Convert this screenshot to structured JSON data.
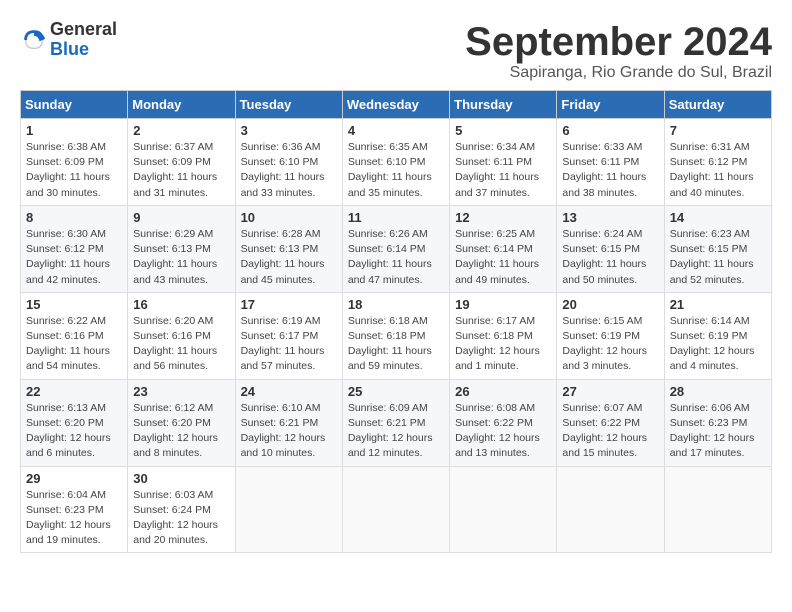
{
  "logo": {
    "general": "General",
    "blue": "Blue"
  },
  "title": "September 2024",
  "subtitle": "Sapiranga, Rio Grande do Sul, Brazil",
  "headers": [
    "Sunday",
    "Monday",
    "Tuesday",
    "Wednesday",
    "Thursday",
    "Friday",
    "Saturday"
  ],
  "weeks": [
    [
      {
        "day": "1",
        "sunrise": "Sunrise: 6:38 AM",
        "sunset": "Sunset: 6:09 PM",
        "daylight": "Daylight: 11 hours and 30 minutes."
      },
      {
        "day": "2",
        "sunrise": "Sunrise: 6:37 AM",
        "sunset": "Sunset: 6:09 PM",
        "daylight": "Daylight: 11 hours and 31 minutes."
      },
      {
        "day": "3",
        "sunrise": "Sunrise: 6:36 AM",
        "sunset": "Sunset: 6:10 PM",
        "daylight": "Daylight: 11 hours and 33 minutes."
      },
      {
        "day": "4",
        "sunrise": "Sunrise: 6:35 AM",
        "sunset": "Sunset: 6:10 PM",
        "daylight": "Daylight: 11 hours and 35 minutes."
      },
      {
        "day": "5",
        "sunrise": "Sunrise: 6:34 AM",
        "sunset": "Sunset: 6:11 PM",
        "daylight": "Daylight: 11 hours and 37 minutes."
      },
      {
        "day": "6",
        "sunrise": "Sunrise: 6:33 AM",
        "sunset": "Sunset: 6:11 PM",
        "daylight": "Daylight: 11 hours and 38 minutes."
      },
      {
        "day": "7",
        "sunrise": "Sunrise: 6:31 AM",
        "sunset": "Sunset: 6:12 PM",
        "daylight": "Daylight: 11 hours and 40 minutes."
      }
    ],
    [
      {
        "day": "8",
        "sunrise": "Sunrise: 6:30 AM",
        "sunset": "Sunset: 6:12 PM",
        "daylight": "Daylight: 11 hours and 42 minutes."
      },
      {
        "day": "9",
        "sunrise": "Sunrise: 6:29 AM",
        "sunset": "Sunset: 6:13 PM",
        "daylight": "Daylight: 11 hours and 43 minutes."
      },
      {
        "day": "10",
        "sunrise": "Sunrise: 6:28 AM",
        "sunset": "Sunset: 6:13 PM",
        "daylight": "Daylight: 11 hours and 45 minutes."
      },
      {
        "day": "11",
        "sunrise": "Sunrise: 6:26 AM",
        "sunset": "Sunset: 6:14 PM",
        "daylight": "Daylight: 11 hours and 47 minutes."
      },
      {
        "day": "12",
        "sunrise": "Sunrise: 6:25 AM",
        "sunset": "Sunset: 6:14 PM",
        "daylight": "Daylight: 11 hours and 49 minutes."
      },
      {
        "day": "13",
        "sunrise": "Sunrise: 6:24 AM",
        "sunset": "Sunset: 6:15 PM",
        "daylight": "Daylight: 11 hours and 50 minutes."
      },
      {
        "day": "14",
        "sunrise": "Sunrise: 6:23 AM",
        "sunset": "Sunset: 6:15 PM",
        "daylight": "Daylight: 11 hours and 52 minutes."
      }
    ],
    [
      {
        "day": "15",
        "sunrise": "Sunrise: 6:22 AM",
        "sunset": "Sunset: 6:16 PM",
        "daylight": "Daylight: 11 hours and 54 minutes."
      },
      {
        "day": "16",
        "sunrise": "Sunrise: 6:20 AM",
        "sunset": "Sunset: 6:16 PM",
        "daylight": "Daylight: 11 hours and 56 minutes."
      },
      {
        "day": "17",
        "sunrise": "Sunrise: 6:19 AM",
        "sunset": "Sunset: 6:17 PM",
        "daylight": "Daylight: 11 hours and 57 minutes."
      },
      {
        "day": "18",
        "sunrise": "Sunrise: 6:18 AM",
        "sunset": "Sunset: 6:18 PM",
        "daylight": "Daylight: 11 hours and 59 minutes."
      },
      {
        "day": "19",
        "sunrise": "Sunrise: 6:17 AM",
        "sunset": "Sunset: 6:18 PM",
        "daylight": "Daylight: 12 hours and 1 minute."
      },
      {
        "day": "20",
        "sunrise": "Sunrise: 6:15 AM",
        "sunset": "Sunset: 6:19 PM",
        "daylight": "Daylight: 12 hours and 3 minutes."
      },
      {
        "day": "21",
        "sunrise": "Sunrise: 6:14 AM",
        "sunset": "Sunset: 6:19 PM",
        "daylight": "Daylight: 12 hours and 4 minutes."
      }
    ],
    [
      {
        "day": "22",
        "sunrise": "Sunrise: 6:13 AM",
        "sunset": "Sunset: 6:20 PM",
        "daylight": "Daylight: 12 hours and 6 minutes."
      },
      {
        "day": "23",
        "sunrise": "Sunrise: 6:12 AM",
        "sunset": "Sunset: 6:20 PM",
        "daylight": "Daylight: 12 hours and 8 minutes."
      },
      {
        "day": "24",
        "sunrise": "Sunrise: 6:10 AM",
        "sunset": "Sunset: 6:21 PM",
        "daylight": "Daylight: 12 hours and 10 minutes."
      },
      {
        "day": "25",
        "sunrise": "Sunrise: 6:09 AM",
        "sunset": "Sunset: 6:21 PM",
        "daylight": "Daylight: 12 hours and 12 minutes."
      },
      {
        "day": "26",
        "sunrise": "Sunrise: 6:08 AM",
        "sunset": "Sunset: 6:22 PM",
        "daylight": "Daylight: 12 hours and 13 minutes."
      },
      {
        "day": "27",
        "sunrise": "Sunrise: 6:07 AM",
        "sunset": "Sunset: 6:22 PM",
        "daylight": "Daylight: 12 hours and 15 minutes."
      },
      {
        "day": "28",
        "sunrise": "Sunrise: 6:06 AM",
        "sunset": "Sunset: 6:23 PM",
        "daylight": "Daylight: 12 hours and 17 minutes."
      }
    ],
    [
      {
        "day": "29",
        "sunrise": "Sunrise: 6:04 AM",
        "sunset": "Sunset: 6:23 PM",
        "daylight": "Daylight: 12 hours and 19 minutes."
      },
      {
        "day": "30",
        "sunrise": "Sunrise: 6:03 AM",
        "sunset": "Sunset: 6:24 PM",
        "daylight": "Daylight: 12 hours and 20 minutes."
      },
      null,
      null,
      null,
      null,
      null
    ]
  ]
}
